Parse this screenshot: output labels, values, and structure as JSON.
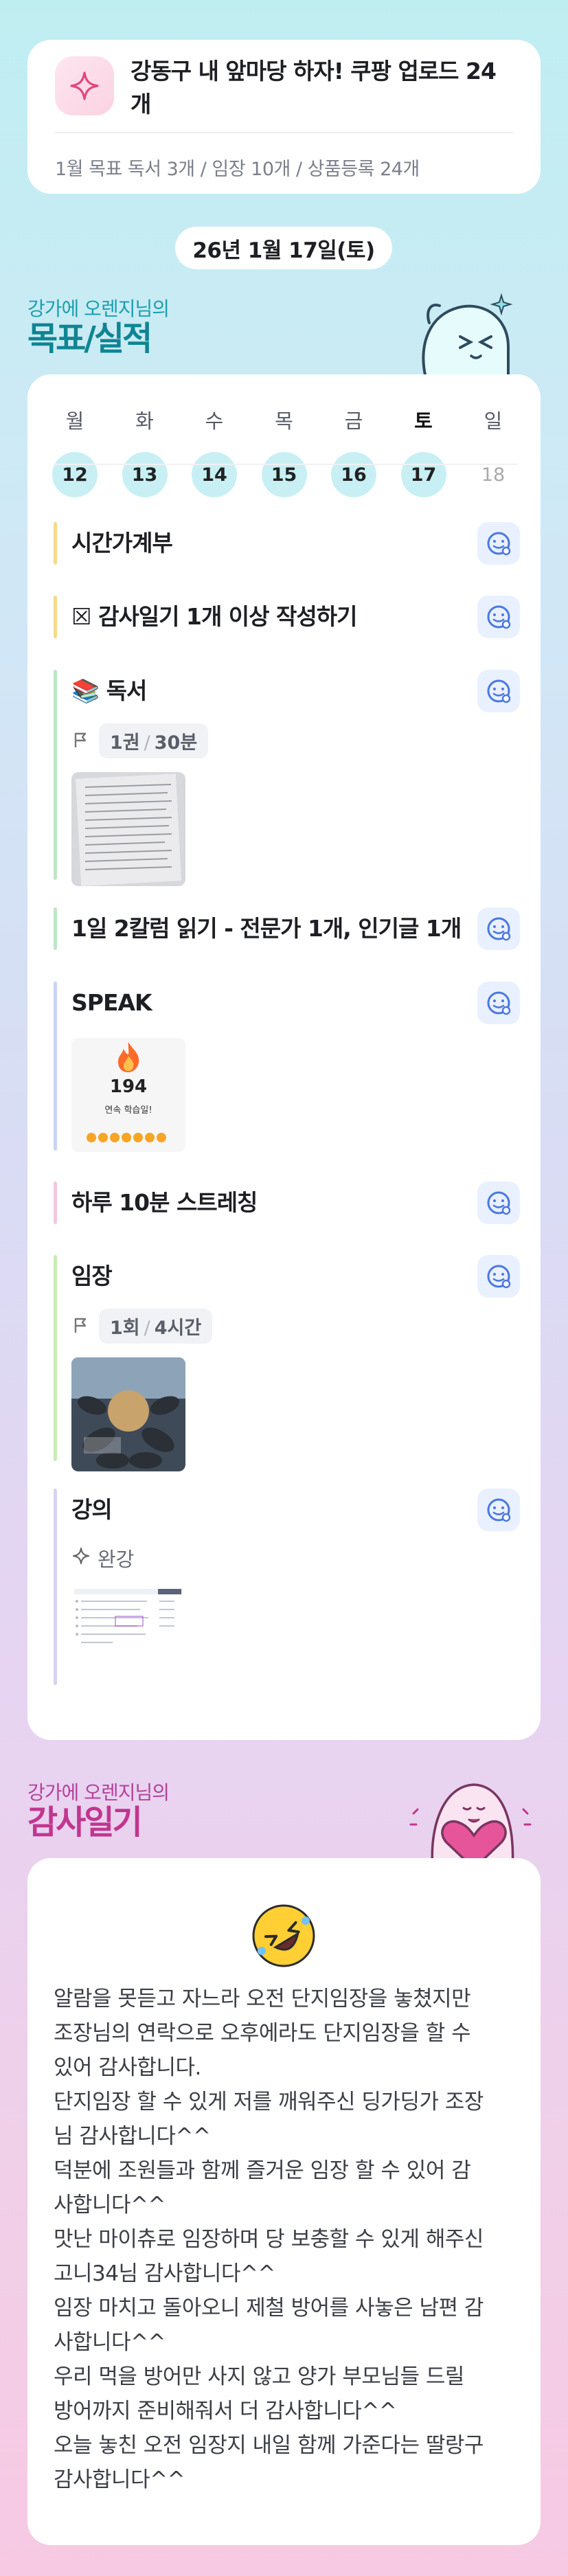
{
  "goal": {
    "title": "강동구 내 앞마당 하자! 쿠팡 업로드 24개",
    "summary": "1월 목표  독서 3개 / 임장 10개 / 상품등록 24개"
  },
  "date": "26년 1월 17일(토)",
  "goals_section": {
    "subtitle": "강가에 오렌지님의",
    "title": "목표/실적"
  },
  "week": [
    {
      "name": "월",
      "num": "12"
    },
    {
      "name": "화",
      "num": "13"
    },
    {
      "name": "수",
      "num": "14"
    },
    {
      "name": "목",
      "num": "15"
    },
    {
      "name": "금",
      "num": "16"
    },
    {
      "name": "토",
      "num": "17"
    },
    {
      "name": "일",
      "num": "18"
    }
  ],
  "tasks": [
    {
      "title": "시간가계부",
      "bar_color": "#f6d98b"
    },
    {
      "title": "☒ 감사일기 1개 이상 작성하기",
      "bar_color": "#f6d98b"
    },
    {
      "title": "📚 독서",
      "bar_color": "#bfe6c4",
      "meta_a": "1권",
      "meta_b": "30분"
    },
    {
      "title": "1일 2칼럼 읽기 - 전문가 1개, 인기글 1개",
      "bar_color": "#bfe6c4"
    },
    {
      "title": "SPEAK",
      "bar_color": "#c7d4f7",
      "streak_count": "194",
      "streak_label": "연속 학습일!"
    },
    {
      "title": "하루 10분 스트레칭",
      "bar_color": "#f3c6e3"
    },
    {
      "title": "임장",
      "bar_color": "#c9ecb4",
      "meta_a": "1회",
      "meta_b": "4시간"
    },
    {
      "title": "강의",
      "bar_color": "#d7d2f3",
      "note": "완강"
    }
  ],
  "diary_section": {
    "subtitle": "강가에 오렌지님의",
    "title": "감사일기"
  },
  "diary": {
    "lines": [
      "알람을 못듣고 자느라 오전 단지임장을 놓쳤지만",
      "조장님의 연락으로 오후에라도 단지임장을 할 수",
      "있어 감사합니다.",
      "단지임장 할 수 있게 저를 깨워주신 딩가딩가 조장",
      "님 감사합니다^^",
      "덕분에 조원들과 함께 즐거운 임장 할 수 있어 감",
      "사합니다^^",
      "맛난 마이츄로 임장하며 당 보충할 수 있게 해주신",
      "고니34님 감사합니다^^",
      "임장 마치고 돌아오니 제철 방어를 사놓은 남편 감",
      "사합니다^^",
      "우리 먹을 방어만 사지 않고 양가 부모님들 드릴",
      "방어까지 준비해줘서 더 감사합니다^^",
      "오늘 놓친 오전 임장지 내일 함께 가준다는 딸랑구",
      "감사합니다^^"
    ]
  },
  "colors": {
    "accent_teal": "#1a9fae",
    "accent_pink": "#c1368f",
    "check_blue": "#4a78e0"
  }
}
